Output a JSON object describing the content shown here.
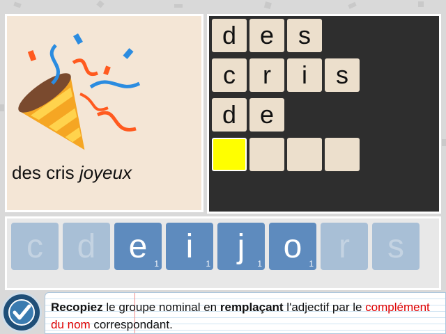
{
  "phrase": {
    "prefix": "des cris ",
    "emphasis": "joyeux"
  },
  "answer_rows": [
    {
      "letters": [
        "d",
        "e",
        "s"
      ]
    },
    {
      "letters": [
        "c",
        "r",
        "i",
        "s"
      ]
    },
    {
      "letters": [
        "d",
        "e"
      ]
    },
    {
      "letters": [
        "",
        "",
        "",
        ""
      ]
    }
  ],
  "letter_bank": [
    {
      "letter": "c",
      "state": "used",
      "count": ""
    },
    {
      "letter": "d",
      "state": "used",
      "count": ""
    },
    {
      "letter": "e",
      "state": "avail",
      "count": "1"
    },
    {
      "letter": "i",
      "state": "avail",
      "count": "1"
    },
    {
      "letter": "j",
      "state": "avail",
      "count": "1"
    },
    {
      "letter": "o",
      "state": "avail",
      "count": "1"
    },
    {
      "letter": "r",
      "state": "used",
      "count": ""
    },
    {
      "letter": "s",
      "state": "used",
      "count": ""
    }
  ],
  "instruction": {
    "bold1": "Recopiez",
    "text1": " le groupe nominal en ",
    "bold2": "remplaçant",
    "text2": " l'adjectif par le ",
    "red": "complément du nom",
    "text3": " correspondant."
  },
  "colors": {
    "active_tile": "#ffff00",
    "letter_available": "#5e8bbe",
    "letter_used": "#a8bfd6",
    "highlight_red": "#e00000"
  },
  "icons": {
    "check": "check-icon",
    "illustration": "party-popper-icon"
  }
}
